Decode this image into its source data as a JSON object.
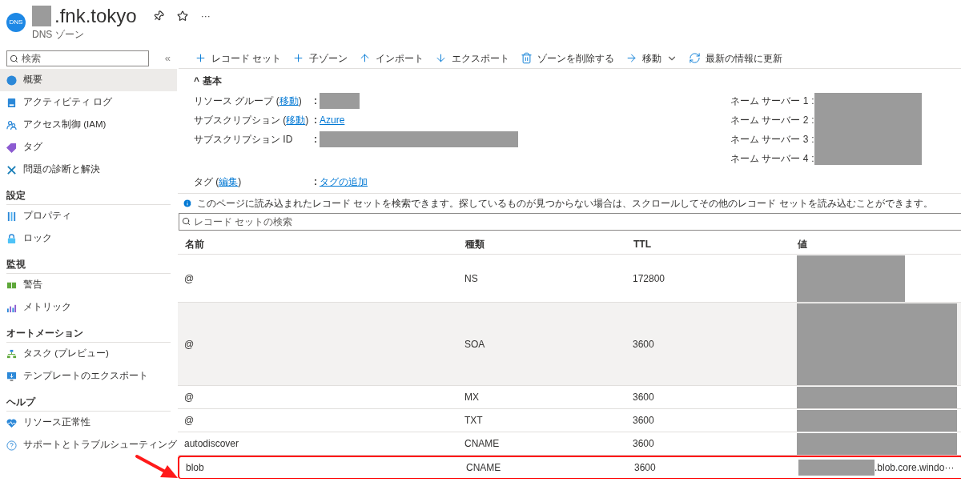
{
  "header": {
    "title": ".fnk.tokyo",
    "subtitle": "DNS ゾーン",
    "badge": "DNS",
    "more": "···"
  },
  "sidebar": {
    "search_placeholder": "検索",
    "collapse": "«",
    "items": [
      {
        "kind": "item",
        "label": "概要",
        "selected": true
      },
      {
        "kind": "item",
        "label": "アクティビティ ログ",
        "selected": false
      },
      {
        "kind": "item",
        "label": "アクセス制御 (IAM)",
        "selected": false
      },
      {
        "kind": "item",
        "label": "タグ",
        "selected": false
      },
      {
        "kind": "item",
        "label": "問題の診断と解決",
        "selected": false
      },
      {
        "kind": "section",
        "label": "設定"
      },
      {
        "kind": "item",
        "label": "プロパティ",
        "selected": false
      },
      {
        "kind": "item",
        "label": "ロック",
        "selected": false
      },
      {
        "kind": "section",
        "label": "監視"
      },
      {
        "kind": "item",
        "label": "警告",
        "selected": false
      },
      {
        "kind": "item",
        "label": "メトリック",
        "selected": false
      },
      {
        "kind": "section",
        "label": "オートメーション"
      },
      {
        "kind": "item",
        "label": "タスク (プレビュー)",
        "selected": false
      },
      {
        "kind": "item",
        "label": "テンプレートのエクスポート",
        "selected": false
      },
      {
        "kind": "section",
        "label": "ヘルプ"
      },
      {
        "kind": "item",
        "label": "リソース正常性",
        "selected": false
      },
      {
        "kind": "item",
        "label": "サポートとトラブルシューティング",
        "selected": false
      }
    ]
  },
  "toolbar": [
    {
      "label": "レコード セット",
      "dropdown": false
    },
    {
      "label": "子ゾーン",
      "dropdown": false
    },
    {
      "label": "インポート",
      "dropdown": false
    },
    {
      "label": "エクスポート",
      "dropdown": false
    },
    {
      "label": "ゾーンを削除する",
      "dropdown": false
    },
    {
      "label": "移動",
      "dropdown": true
    },
    {
      "label": "最新の情報に更新",
      "dropdown": false
    }
  ],
  "essentials": {
    "caret": "^",
    "title": "基本",
    "expanded": true,
    "fields": [
      {
        "label": "リソース グループ (",
        "link": "移動",
        "after": ")",
        "colon": ":",
        "kind": "redacted"
      },
      {
        "label": "サブスクリプション (",
        "link": "移動",
        "after": ")",
        "colon": ":",
        "kind": "link",
        "value": "Azure"
      },
      {
        "label": "サブスクリプション ID",
        "colon": ":",
        "kind": "redacted"
      },
      {
        "label": "タグ (",
        "link": "編集",
        "after": ")",
        "colon": ":",
        "kind": "link",
        "value": "タグの追加"
      }
    ],
    "name_servers": [
      {
        "label": "ネーム サーバー 1",
        "colon": ":"
      },
      {
        "label": "ネーム サーバー 2",
        "colon": ":"
      },
      {
        "label": "ネーム サーバー 3",
        "colon": ":"
      },
      {
        "label": "ネーム サーバー 4",
        "colon": ":"
      }
    ]
  },
  "info": "このページに読み込まれたレコード セットを検索できます。探しているものが見つからない場合は、スクロールしてその他のレコード セットを読み込むことができます。",
  "record_search": {
    "placeholder": "レコード セットの検索"
  },
  "table": {
    "columns": [
      "名前",
      "種類",
      "TTL",
      "値"
    ],
    "rows": [
      {
        "name": "@",
        "type": "NS",
        "ttl": "172800",
        "hovered": false,
        "annotated": false
      },
      {
        "name": "@",
        "type": "SOA",
        "ttl": "3600",
        "hovered": true,
        "annotated": false
      },
      {
        "name": "@",
        "type": "MX",
        "ttl": "3600",
        "hovered": false,
        "annotated": false
      },
      {
        "name": "@",
        "type": "TXT",
        "ttl": "3600",
        "hovered": false,
        "annotated": false
      },
      {
        "name": "autodiscover",
        "type": "CNAME",
        "ttl": "3600",
        "hovered": false,
        "annotated": false
      },
      {
        "name": "blob",
        "type": "CNAME",
        "ttl": "3600",
        "value": ".blob.core.windo···",
        "hovered": false,
        "annotated": true
      }
    ]
  }
}
